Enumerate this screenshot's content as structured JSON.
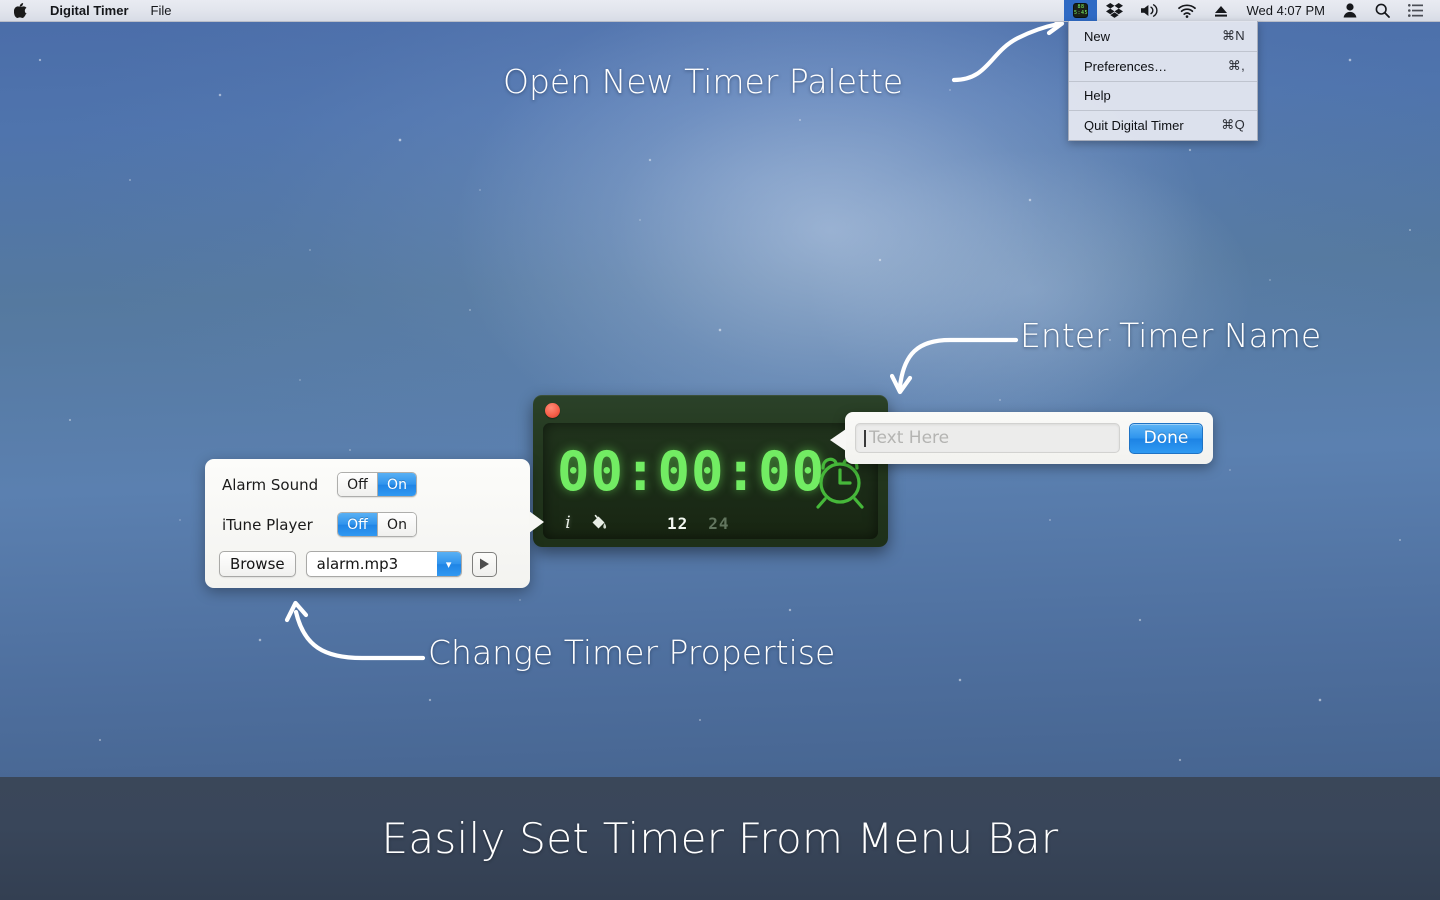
{
  "menubar": {
    "apple_glyph": "",
    "app_name": "Digital Timer",
    "file_menu": "File",
    "clock": "Wed 4:07 PM",
    "status_icons": [
      "timer-icon",
      "dropbox-icon",
      "volume-icon",
      "wifi-icon",
      "eject-icon",
      "user-icon",
      "search-icon",
      "list-icon"
    ],
    "timer_icon_digits_top": "88",
    "timer_icon_digits_bottom": "5:45"
  },
  "dropdown": {
    "items": [
      {
        "label": "New",
        "shortcut": "⌘N"
      },
      {
        "label": "Preferences…",
        "shortcut": "⌘,"
      },
      {
        "label": "Help",
        "shortcut": ""
      },
      {
        "label": "Quit Digital Timer",
        "shortcut": "⌘Q"
      }
    ]
  },
  "callouts": {
    "new_timer": "Open New Timer Palette",
    "timer_name": "Enter Timer Name",
    "properties": "Change Timer Propertise"
  },
  "timer_widget": {
    "display": "00:00:00",
    "close_button": "close",
    "alarm_icon": "alarm-clock-icon",
    "info_icon": "i",
    "fill_icon": "paint-bucket-icon",
    "format_12": "12",
    "format_24": "24",
    "active_format": "12",
    "digit_color": "#72ec63",
    "body_color": "#24381f"
  },
  "name_popover": {
    "placeholder": "Text Here",
    "value": "",
    "done_label": "Done",
    "accent_color": "#2f95ee"
  },
  "properties": {
    "rows": [
      {
        "label": "Alarm Sound",
        "off": "Off",
        "on": "On",
        "selected": "On"
      },
      {
        "label": "iTune Player",
        "off": "Off",
        "on": "On",
        "selected": "Off"
      }
    ],
    "browse_label": "Browse",
    "sound_file": "alarm.mp3",
    "play_label": "play",
    "chevron": "▾"
  },
  "banner": {
    "text": "Easily Set Timer From Menu Bar",
    "background": "#39465a"
  }
}
